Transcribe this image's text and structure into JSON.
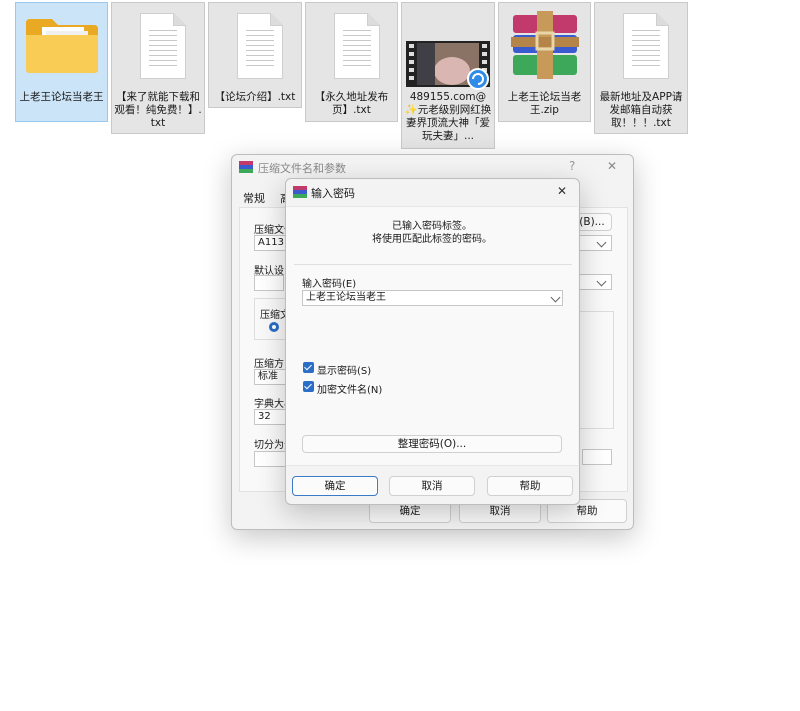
{
  "desktop": {
    "files": [
      {
        "name": "上老王论坛当老王",
        "type": "folder",
        "icon": "folder-icon"
      },
      {
        "name": "【来了就能下载和观看！纯免费！】.txt",
        "type": "txt",
        "icon": "text-file-icon"
      },
      {
        "name": "【论坛介绍】.txt",
        "type": "txt",
        "icon": "text-file-icon"
      },
      {
        "name": "【永久地址发布页】.txt",
        "type": "txt",
        "icon": "text-file-icon"
      },
      {
        "name": "489155.com@✨元老级别网红换妻界顶流大神「爱玩夫妻」...",
        "type": "video",
        "icon": "video-file-icon"
      },
      {
        "name": "上老王论坛当老王.zip",
        "type": "zip",
        "icon": "winrar-archive-icon"
      },
      {
        "name": "最新地址及APP请发邮箱自动获取！！！.txt",
        "type": "txt",
        "icon": "text-file-icon"
      }
    ]
  },
  "archive_dialog": {
    "title": "压缩文件名和参数",
    "help_glyph": "?",
    "close_glyph": "✕",
    "tabs": [
      "常规",
      "高"
    ],
    "archive_name_label": "压缩文件",
    "archive_name_value": "A113",
    "browse_label": "(B)...",
    "default_profile_label": "默认设",
    "format_label": "压缩文",
    "method_label": "压缩方",
    "method_value": "标准",
    "dict_label": "字典大小",
    "dict_value": "32",
    "split_label": "切分为分",
    "ok_label": "确定",
    "cancel_label": "取消",
    "help_label": "帮助"
  },
  "password_dialog": {
    "title": "输入密码",
    "close_glyph": "✕",
    "info_line1": "已输入密码标签。",
    "info_line2": "将使用匹配此标签的密码。",
    "password_label": "输入密码(E)",
    "password_value": "上老王论坛当老王",
    "show_password_label": "显示密码(S)",
    "show_password_checked": true,
    "encrypt_names_label": "加密文件名(N)",
    "encrypt_names_checked": true,
    "organize_label": "整理密码(O)...",
    "ok_label": "确定",
    "cancel_label": "取消",
    "help_label": "帮助"
  },
  "colors": {
    "selected_tile": "#cce4f7",
    "accent_blue": "#2a6ec6",
    "folder_yellow": "#f5c242"
  }
}
